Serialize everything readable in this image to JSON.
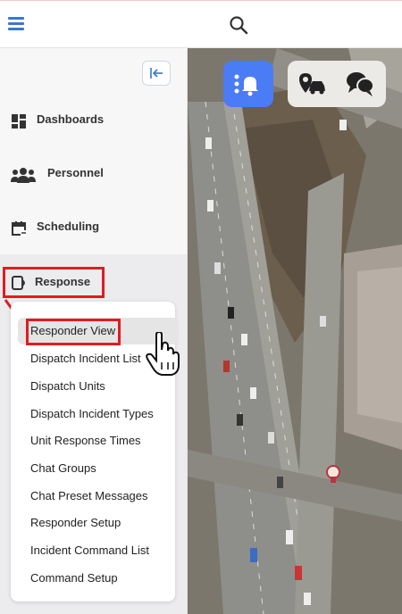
{
  "sidebar": {
    "items": [
      {
        "label": "Dashboards",
        "icon": "dashboard-icon"
      },
      {
        "label": "Personnel",
        "icon": "people-icon"
      },
      {
        "label": "Scheduling",
        "icon": "calendar-icon"
      },
      {
        "label": "Response",
        "icon": "response-icon"
      }
    ],
    "response_submenu": [
      "Responder View",
      "Dispatch Incident List",
      "Dispatch Units",
      "Dispatch Incident Types",
      "Unit Response Times",
      "Chat Groups",
      "Chat Preset Messages",
      "Responder Setup",
      "Incident Command List",
      "Command Setup"
    ]
  },
  "colors": {
    "accent": "#3a78c9",
    "annotation": "#e11b22",
    "notify_button": "#4a7cf5"
  },
  "icons": {
    "menu": "hamburger-icon",
    "search": "search-icon",
    "collapse": "collapse-left-icon",
    "cursor": "hand-pointer-icon",
    "notify": "notification-bell-icon",
    "vehicle": "vehicle-location-icon",
    "chat": "chat-icon"
  }
}
